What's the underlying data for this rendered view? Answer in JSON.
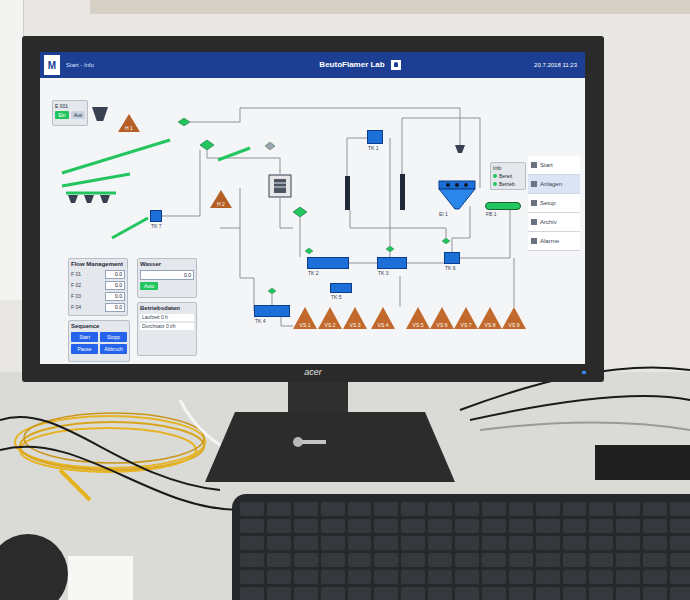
{
  "monitor": {
    "brand": "acer",
    "power_on": true
  },
  "hmi": {
    "header": {
      "logo": "M",
      "breadcrumb": "Start - Info",
      "title": "BeutoFlamer Lab",
      "datetime": "20.7.2018 11:23"
    },
    "nav": [
      {
        "label": "Start",
        "selected": false
      },
      {
        "label": "Anlagen",
        "selected": true
      },
      {
        "label": "Setup",
        "selected": false
      },
      {
        "label": "Archiv",
        "selected": false
      },
      {
        "label": "Alarme",
        "selected": false
      }
    ],
    "feed_box": {
      "title": "E 001",
      "buttons": [
        {
          "label": "Ein",
          "on": true
        },
        {
          "label": "Aus",
          "on": false
        }
      ]
    },
    "status_box": {
      "title": "Info",
      "items": [
        {
          "label": "Bereit",
          "on": true
        },
        {
          "label": "Betrieb",
          "on": true
        }
      ]
    },
    "units": [
      {
        "kind": "tank",
        "label": "TK 1"
      },
      {
        "kind": "tank",
        "label": "TK 2"
      },
      {
        "kind": "tank",
        "label": "TK 3"
      },
      {
        "kind": "tank",
        "label": "TK 4"
      },
      {
        "kind": "tank",
        "label": "TK 5"
      },
      {
        "kind": "tank",
        "label": "TK 6"
      },
      {
        "kind": "tank",
        "label": "TK 7"
      },
      {
        "kind": "cone",
        "label": "EI 1"
      },
      {
        "kind": "mill"
      },
      {
        "kind": "column"
      },
      {
        "kind": "column"
      },
      {
        "kind": "pump",
        "running": true
      },
      {
        "kind": "pump",
        "running": true
      },
      {
        "kind": "pump",
        "running": true
      },
      {
        "kind": "pump",
        "running": true
      },
      {
        "kind": "pump",
        "running": true
      },
      {
        "kind": "pump",
        "running": true
      },
      {
        "kind": "pump",
        "running": true
      },
      {
        "kind": "pump",
        "running": false
      },
      {
        "kind": "conveyor",
        "label": "FB 1",
        "running": true
      },
      {
        "kind": "hopper"
      },
      {
        "kind": "hopper"
      },
      {
        "kind": "hopper"
      },
      {
        "kind": "hopper"
      },
      {
        "kind": "hopper"
      }
    ],
    "belts": [
      {
        "running": true
      },
      {
        "running": true
      },
      {
        "running": true
      },
      {
        "running": true
      },
      {
        "running": true
      }
    ],
    "stockpiles": [
      {
        "label": "H 1"
      },
      {
        "label": "H 2"
      }
    ],
    "bins": [
      {
        "label": "VS 1"
      },
      {
        "label": "VS 2"
      },
      {
        "label": "VS 3"
      },
      {
        "label": "VS 4"
      },
      {
        "label": "VS 5"
      },
      {
        "label": "VS 6"
      },
      {
        "label": "VS 7"
      },
      {
        "label": "VS 8"
      },
      {
        "label": "VS 9"
      }
    ],
    "flow_panel": {
      "title": "Flow Management",
      "rows": [
        {
          "label": "F 01",
          "value": "0.0"
        },
        {
          "label": "F 02",
          "value": "0.0"
        },
        {
          "label": "F 03",
          "value": "0.0"
        },
        {
          "label": "F 04",
          "value": "0.0"
        }
      ]
    },
    "water_panel": {
      "title": "Wasser",
      "value": "0.0",
      "mode": "Auto",
      "mode_on": true
    },
    "info_panel": {
      "title": "Betriebsdaten",
      "lines": [
        "Laufzeit 0 h",
        "Durchsatz 0 t/h"
      ]
    },
    "sequence_panel": {
      "title": "Sequence",
      "buttons": [
        "Start",
        "Stopp",
        "Pause",
        "Abbruch"
      ]
    }
  }
}
